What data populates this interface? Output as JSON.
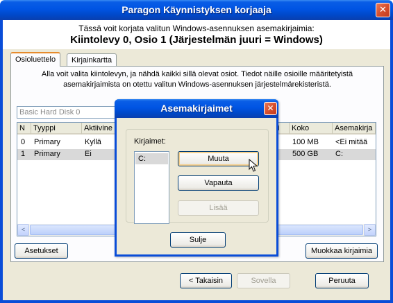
{
  "window": {
    "title": "Paragon Käynnistyksen korjaaja",
    "close_glyph": "✕"
  },
  "header": {
    "subtitle": "Tässä voit korjata valitun Windows-asennuksen asemakirjaimia:",
    "title": "Kiintolevy 0, Osio 1 (Järjestelmän juuri = Windows)"
  },
  "tabs": [
    {
      "label": "Osioluettelo",
      "active": true
    },
    {
      "label": "Kirjainkartta",
      "active": false
    }
  ],
  "panel": {
    "description": "Alla voit valita kiintolevyn, ja nähdä kaikki sillä olevat osiot. Tiedot näille osioille määritetyistä asemakirjaimista on otettu valitun Windows-asennuksen järjestelmärekisteristä.",
    "disk_combo_value": "Basic Hard Disk 0"
  },
  "table": {
    "columns": [
      "N",
      "Tyyppi",
      "Aktiivine",
      "i",
      "Koko",
      "Asemakirja"
    ],
    "rows": [
      {
        "n": "0",
        "type": "Primary",
        "active": "Kyllä",
        "size": "100 MB",
        "letter": "<Ei mitää",
        "selected": false
      },
      {
        "n": "1",
        "type": "Primary",
        "active": "Ei",
        "size": "500 GB",
        "letter": "C:",
        "selected": true
      }
    ]
  },
  "buttons": {
    "settings": "Asetukset",
    "edit_letters": "Muokkaa kirjaimia",
    "back": "< Takaisin",
    "apply": "Sovella",
    "cancel": "Peruuta"
  },
  "dialog": {
    "title": "Asemakirjaimet",
    "group_label": "Kirjaimet:",
    "letters": [
      "C:"
    ],
    "change": "Muuta",
    "release": "Vapauta",
    "add": "Lisää",
    "close": "Sulje"
  },
  "scroll": {
    "left": "<",
    "right": ">"
  }
}
